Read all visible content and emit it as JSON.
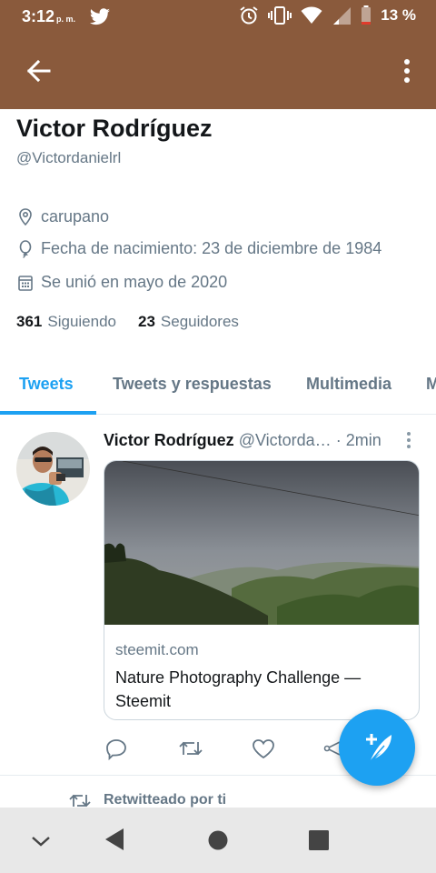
{
  "status_bar": {
    "time": "3:12",
    "ampm": "p. m.",
    "battery": "13 %"
  },
  "app_bar": {
    "back_icon": "arrow-left-icon",
    "more_icon": "more-vertical-icon"
  },
  "profile": {
    "name": "Victor Rodríguez",
    "handle": "@Victordanielrl",
    "location": "carupano",
    "birthday": "Fecha de nacimiento: 23 de diciembre de 1984",
    "joined": "Se unió en mayo de 2020",
    "following_count": "361",
    "following_label": "Siguiendo",
    "followers_count": "23",
    "followers_label": "Seguidores"
  },
  "tabs": [
    {
      "label": "Tweets",
      "active": true
    },
    {
      "label": "Tweets y respuestas",
      "active": false
    },
    {
      "label": "Multimedia",
      "active": false
    },
    {
      "label": "M",
      "active": false
    }
  ],
  "tweet": {
    "name": "Victor Rodríguez",
    "handle": "@Victorda…",
    "time": "· 2min",
    "card": {
      "domain": "steemit.com",
      "title": "Nature Photography Challenge — Steemit"
    }
  },
  "retweet_line": "Retwitteado por ti",
  "colors": {
    "accent": "#1da1f2",
    "top_bar": "#8a5a3c",
    "secondary_text": "#657786"
  }
}
